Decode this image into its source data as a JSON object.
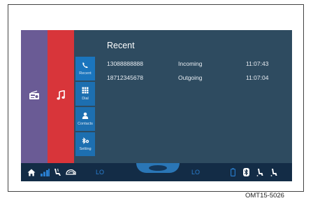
{
  "sidebar": {
    "radio_icon": "radio-icon",
    "music_icon": "music-note-icon"
  },
  "tabs": [
    {
      "label": "Recent",
      "icon": "phone-icon"
    },
    {
      "label": "Dial",
      "icon": "keypad-icon"
    },
    {
      "label": "Contacts",
      "icon": "person-icon"
    },
    {
      "label": "Setting",
      "icon": "bluetooth-setting-icon"
    }
  ],
  "recent": {
    "title": "Recent",
    "calls": [
      {
        "number": "13088888888",
        "direction": "Incoming",
        "time": "11:07:43"
      },
      {
        "number": "18712345678",
        "direction": "Outgoing",
        "time": "11:07:04"
      }
    ]
  },
  "statusbar": {
    "temp_left": "LO",
    "temp_right": "LO"
  },
  "caption": "OMT15-5026",
  "colors": {
    "screen_bg": "#293f52",
    "radio_column": "#6a5b95",
    "music_column": "#d8353a",
    "tab_blue": "#1b75bd",
    "statusbar_bg": "#132c46",
    "accent_blue": "#2a7fd0"
  }
}
